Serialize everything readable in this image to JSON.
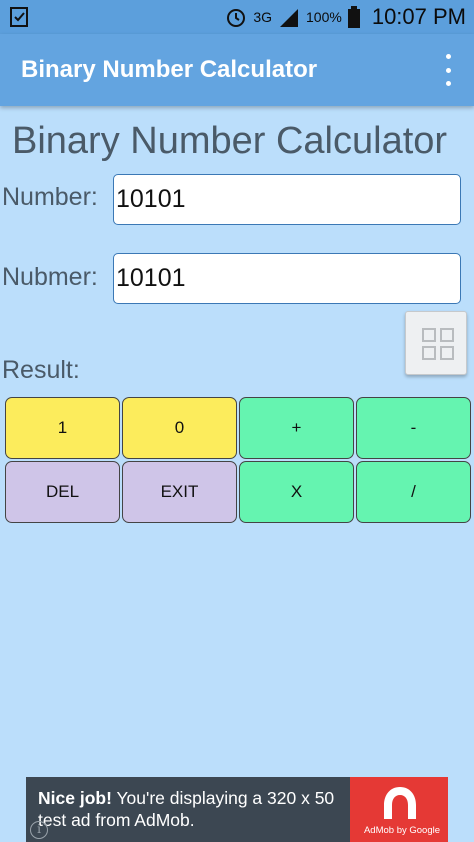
{
  "status_bar": {
    "network": "3G",
    "battery": "100%",
    "time": "10:07 PM",
    "icons": [
      "notification-check-icon",
      "alarm-icon",
      "signal-icon",
      "battery-icon"
    ]
  },
  "app_bar": {
    "title": "Binary Number Calculator",
    "menu_icon": "more-vert-icon"
  },
  "main": {
    "heading": "Binary Number Calculator",
    "number_label": "Number:",
    "number_value": "10101",
    "nubmer_label": "Nubmer:",
    "nubmer_value": "10101",
    "result_label": "Result:",
    "grid_icon": "grid-icon"
  },
  "keypad": {
    "keys": [
      {
        "label": "1",
        "color": "#fcec5c"
      },
      {
        "label": "0",
        "color": "#fcec5c"
      },
      {
        "label": "+",
        "color": "#65f4b0"
      },
      {
        "label": "-",
        "color": "#65f4b0"
      },
      {
        "label": "DEL",
        "color": "#cfc5e8"
      },
      {
        "label": "EXIT",
        "color": "#cfc5e8"
      },
      {
        "label": "X",
        "color": "#65f4b0"
      },
      {
        "label": "/",
        "color": "#65f4b0"
      }
    ]
  },
  "ad": {
    "headline": "Nice job!",
    "body": " You're displaying a 320 x 50 test ad from AdMob.",
    "brand": "AdMob by Google",
    "accent": "#e53935"
  },
  "colors": {
    "background": "#bbdefb",
    "app_bar": "#63a4e0",
    "status_bar": "#5c9fdc"
  }
}
